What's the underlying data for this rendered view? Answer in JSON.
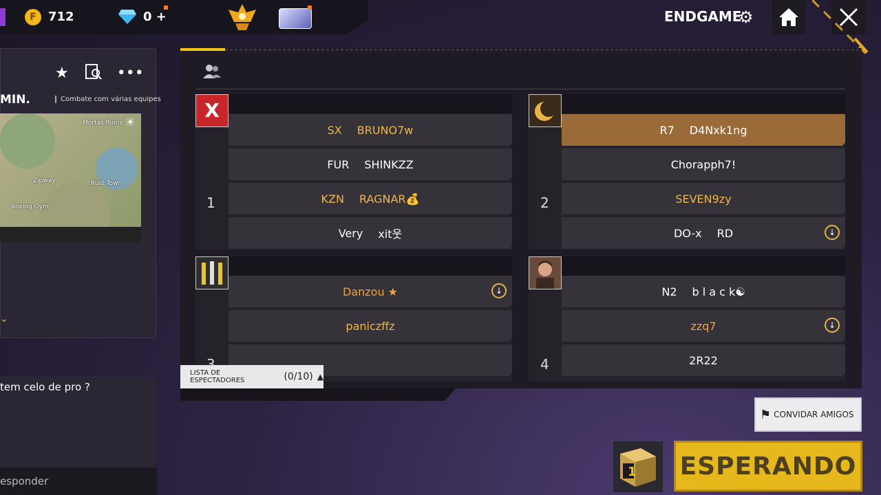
{
  "topbar": {
    "coins": "712",
    "diamonds": "0 +",
    "server_label": "ENDGAME"
  },
  "left": {
    "mode_label": "MIN.",
    "mode_sub": "Combate com várias equipes",
    "map_labels": [
      "Mortas Ruins",
      "Zipway",
      "Rust Town",
      "Boxing Gym"
    ],
    "chat_message": "tem celo de pro ?",
    "chat_placeholder": "esponder"
  },
  "teams": [
    {
      "number": "1",
      "players": [
        {
          "tag": "SX",
          "name": "BRUNO7w",
          "color": "gold"
        },
        {
          "tag": "FUR",
          "name": "SHINKZZ",
          "color": "white"
        },
        {
          "tag": "KZN",
          "name": "RAGNAR💰",
          "color": "gold"
        },
        {
          "tag": "Very",
          "name": "xit웃",
          "color": "white"
        }
      ]
    },
    {
      "number": "2",
      "players": [
        {
          "tag": "R7",
          "name": "D4Nxk1ng",
          "color": "white",
          "highlight": true
        },
        {
          "tag": "",
          "name": "Chorapph7!",
          "color": "white"
        },
        {
          "tag": "",
          "name": "SEVEN9zy",
          "color": "gold"
        },
        {
          "tag": "DO-x",
          "name": "RD",
          "color": "white",
          "cloud": true
        }
      ]
    },
    {
      "number": "3",
      "players": [
        {
          "tag": "",
          "name": "Danzou ★",
          "color": "orange",
          "cloud": true
        },
        {
          "tag": "",
          "name": "paniczffz",
          "color": "gold"
        },
        {
          "tag": "",
          "name": "",
          "color": "white"
        }
      ]
    },
    {
      "number": "4",
      "players": [
        {
          "tag": "N2",
          "name": "b l a c k☯",
          "color": "white"
        },
        {
          "tag": "",
          "name": "zzq7",
          "color": "orange",
          "cloud": true
        },
        {
          "tag": "",
          "name": "2R22",
          "color": "white"
        }
      ]
    }
  ],
  "spectators": {
    "label": "LISTA DE ESPECTADORES",
    "count": "(0/10)"
  },
  "invite_label": "CONVIDAR AMIGOS",
  "room_number": "1",
  "waiting_label": "ESPERANDO",
  "colors": {
    "accent": "#f0c419",
    "highlight": "#9a6b38",
    "gold": "#efb64a"
  },
  "icons": [
    "coin-icon",
    "diamond-icon",
    "rank-icon",
    "pass-icon",
    "gear-icon",
    "home-icon",
    "close-icon",
    "star-icon",
    "search-doc-icon",
    "more-icon",
    "people-icon",
    "cloud-icon",
    "flag-icon",
    "cube-icon"
  ]
}
